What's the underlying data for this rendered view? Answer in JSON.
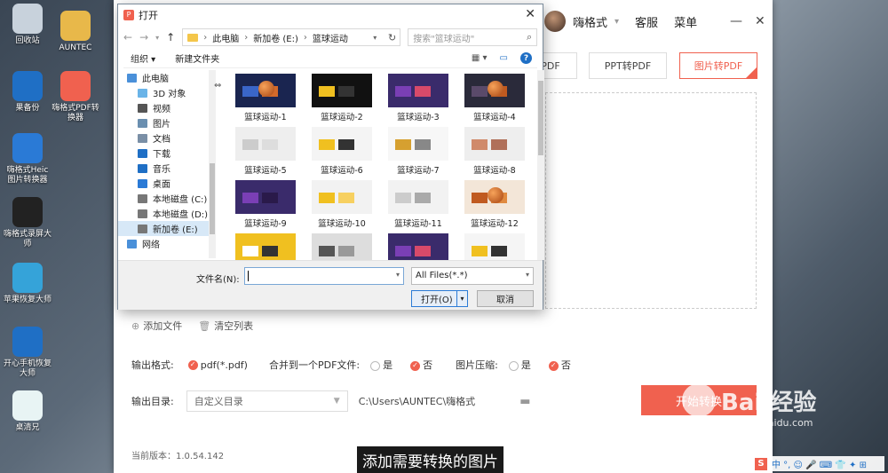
{
  "desktop": {
    "icons": [
      {
        "label": "回收站",
        "icon": "recycle-bin-icon",
        "color": "#c8d2dc"
      },
      {
        "label": "AUNTEC",
        "icon": "user-folder-icon",
        "color": "#e8b84a"
      },
      {
        "label": "果备份",
        "icon": "backup-icon",
        "color": "#1f6fc5"
      },
      {
        "label": "嗨格式PDF转换器",
        "icon": "pdf-converter-icon",
        "color": "#f0614f"
      },
      {
        "label": "嗨格式Heic图片转换器",
        "icon": "heic-converter-icon",
        "color": "#2a7ad6"
      },
      {
        "label": "嗨格式录屏大师",
        "icon": "screen-recorder-icon",
        "color": "#222222"
      },
      {
        "label": "苹果恢复大师",
        "icon": "apple-recovery-icon",
        "color": "#35a3d9"
      },
      {
        "label": "开心手机恢复大师",
        "icon": "phone-recovery-icon",
        "color": "#1f6fc5"
      },
      {
        "label": "桌清兄",
        "icon": "desk-cleaner-icon",
        "color": "#e8f4f4"
      }
    ]
  },
  "app": {
    "username": "嗨格式",
    "menu_service": "客服",
    "menu_main": "菜单",
    "tabs": [
      "PDF",
      "PPT转PDF",
      "图片转PDF"
    ],
    "add_file": "添加文件",
    "clear_list": "清空列表",
    "output_format_label": "输出格式:",
    "output_format_value": "pdf(*.pdf)",
    "merge_label": "合并到一个PDF文件:",
    "compress_label": "图片压缩:",
    "yes": "是",
    "no": "否",
    "output_dir_label": "输出目录:",
    "output_dir_select": "自定义目录",
    "output_path": "C:\\Users\\AUNTEC\\嗨格式",
    "start_button": "开始转换",
    "version": "当前版本：1.0.54.142",
    "accent": "#f0614f"
  },
  "dialog": {
    "title": "打开",
    "breadcrumb": [
      "此电脑",
      "新加卷 (E:)",
      "篮球运动"
    ],
    "search_placeholder": "搜索\"篮球运动\"",
    "organize": "组织 ▾",
    "new_folder": "新建文件夹",
    "nav_items": [
      {
        "label": "此电脑",
        "icon": "computer-icon",
        "color": "#4a90d9",
        "top": true
      },
      {
        "label": "3D 对象",
        "icon": "3d-objects-icon",
        "color": "#6ab4e8"
      },
      {
        "label": "视频",
        "icon": "video-icon",
        "color": "#555555"
      },
      {
        "label": "图片",
        "icon": "pictures-icon",
        "color": "#6a8fb0"
      },
      {
        "label": "文档",
        "icon": "documents-icon",
        "color": "#7a8fa6"
      },
      {
        "label": "下载",
        "icon": "download-icon",
        "color": "#1f6fc5"
      },
      {
        "label": "音乐",
        "icon": "music-icon",
        "color": "#1f6fc5"
      },
      {
        "label": "桌面",
        "icon": "desktop-icon",
        "color": "#2a7ad6"
      },
      {
        "label": "本地磁盘 (C:)",
        "icon": "drive-c-icon",
        "color": "#777777"
      },
      {
        "label": "本地磁盘 (D:)",
        "icon": "drive-d-icon",
        "color": "#777777"
      },
      {
        "label": "新加卷 (E:)",
        "icon": "drive-e-icon",
        "color": "#777777",
        "selected": true
      },
      {
        "label": "网络",
        "icon": "network-icon",
        "color": "#4a90d9",
        "top": true
      }
    ],
    "files": [
      {
        "label": "篮球运动-1",
        "bg": "#1a2550",
        "a": "#3a66c8",
        "b": "#d36a2a",
        "ball": true
      },
      {
        "label": "篮球运动-2",
        "bg": "#111111",
        "a": "#f0c020",
        "b": "#333333"
      },
      {
        "label": "篮球运动-3",
        "bg": "#3a2b6b",
        "a": "#7a3fb5",
        "b": "#d84a6a"
      },
      {
        "label": "篮球运动-4",
        "bg": "#2a2a3a",
        "a": "#5a4a6a",
        "b": "#c05a20",
        "ball": true
      },
      {
        "label": "篮球运动-5",
        "bg": "#eeeeee",
        "a": "#cccccc",
        "b": "#dddddd"
      },
      {
        "label": "篮球运动-6",
        "bg": "#f4f4f4",
        "a": "#f0c020",
        "b": "#333333"
      },
      {
        "label": "篮球运动-7",
        "bg": "#f7f7f7",
        "a": "#d6a030",
        "b": "#888888"
      },
      {
        "label": "篮球运动-8",
        "bg": "#eeeeee",
        "a": "#d08a6a",
        "b": "#b0705a"
      },
      {
        "label": "篮球运动-9",
        "bg": "#3a2b6b",
        "a": "#7a3fb5",
        "b": "#2a1a4a"
      },
      {
        "label": "篮球运动-10",
        "bg": "#f2f2f2",
        "a": "#f0c020",
        "b": "#f7d060"
      },
      {
        "label": "篮球运动-11",
        "bg": "#f2f2f2",
        "a": "#cccccc",
        "b": "#aaaaaa"
      },
      {
        "label": "篮球运动-12",
        "bg": "#f3e6d8",
        "a": "#c05a20",
        "b": "#e08a40",
        "ball": true
      },
      {
        "label": "",
        "bg": "#f0c020",
        "a": "#ffffff",
        "b": "#333333"
      },
      {
        "label": "",
        "bg": "#dddddd",
        "a": "#555555",
        "b": "#999999"
      },
      {
        "label": "",
        "bg": "#3a2b6b",
        "a": "#7a3fb5",
        "b": "#d84a6a"
      },
      {
        "label": "",
        "bg": "#f5f5f5",
        "a": "#f0c020",
        "b": "#333333"
      }
    ],
    "filename_label": "文件名(N):",
    "filename_value": "",
    "filetype": "All Files(*.*)",
    "open_button": "打开(O)",
    "cancel_button": "取消"
  },
  "overlay": {
    "subtitle": "添加需要转换的图片",
    "watermark_brand": "Bai 经验",
    "watermark_url": "jingyan.baidu.com",
    "tray_text": "中 °, ☺ 🎤 ⌨ 👕 ✦ ⊞"
  }
}
